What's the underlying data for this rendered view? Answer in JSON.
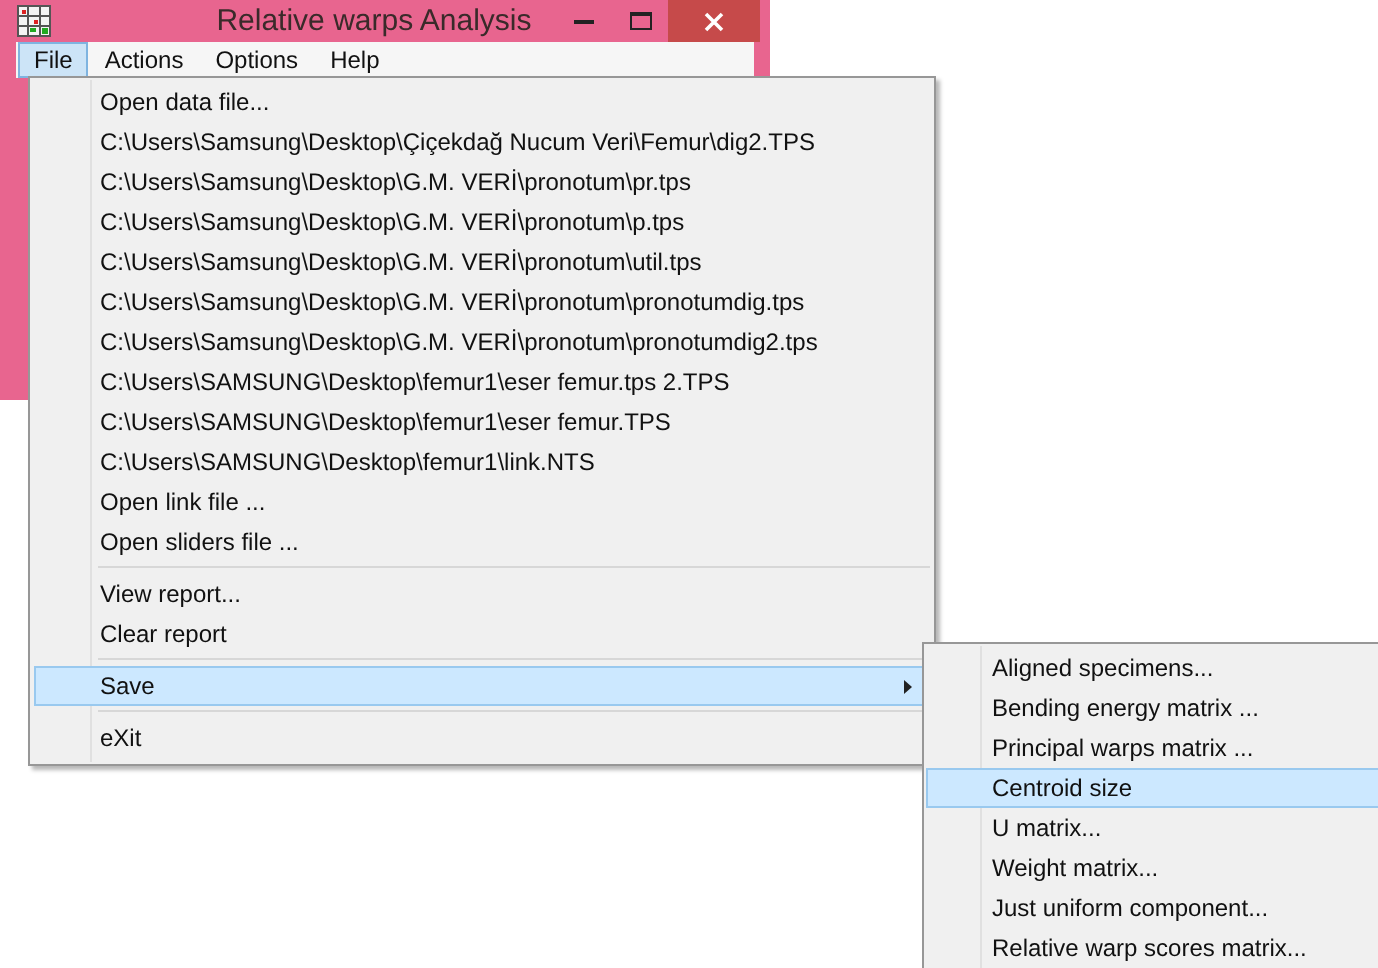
{
  "window": {
    "title": "Relative warps Analysis"
  },
  "menu_bar": [
    {
      "label": "File",
      "selected": true
    },
    {
      "label": "Actions",
      "selected": false
    },
    {
      "label": "Options",
      "selected": false
    },
    {
      "label": "Help",
      "selected": false
    }
  ],
  "file_menu": [
    {
      "kind": "item",
      "label": "Open data file...",
      "selected": false
    },
    {
      "kind": "item",
      "label": "C:\\Users\\Samsung\\Desktop\\Çiçekdağ Nucum Veri\\Femur\\dig2.TPS",
      "selected": false
    },
    {
      "kind": "item",
      "label": "C:\\Users\\Samsung\\Desktop\\G.M. VERİ\\pronotum\\pr.tps",
      "selected": false
    },
    {
      "kind": "item",
      "label": "C:\\Users\\Samsung\\Desktop\\G.M. VERİ\\pronotum\\p.tps",
      "selected": false
    },
    {
      "kind": "item",
      "label": "C:\\Users\\Samsung\\Desktop\\G.M. VERİ\\pronotum\\util.tps",
      "selected": false
    },
    {
      "kind": "item",
      "label": "C:\\Users\\Samsung\\Desktop\\G.M. VERİ\\pronotum\\pronotumdig.tps",
      "selected": false
    },
    {
      "kind": "item",
      "label": "C:\\Users\\Samsung\\Desktop\\G.M. VERİ\\pronotum\\pronotumdig2.tps",
      "selected": false
    },
    {
      "kind": "item",
      "label": "C:\\Users\\SAMSUNG\\Desktop\\femur1\\eser femur.tps 2.TPS",
      "selected": false
    },
    {
      "kind": "item",
      "label": "C:\\Users\\SAMSUNG\\Desktop\\femur1\\eser femur.TPS",
      "selected": false
    },
    {
      "kind": "item",
      "label": "C:\\Users\\SAMSUNG\\Desktop\\femur1\\link.NTS",
      "selected": false
    },
    {
      "kind": "item",
      "label": "Open link file ...",
      "selected": false
    },
    {
      "kind": "item",
      "label": "Open sliders file ...",
      "selected": false
    },
    {
      "kind": "separator"
    },
    {
      "kind": "item",
      "label": "View report...",
      "selected": false
    },
    {
      "kind": "item",
      "label": "Clear report",
      "selected": false
    },
    {
      "kind": "separator"
    },
    {
      "kind": "submenu",
      "label": "Save",
      "selected": true
    },
    {
      "kind": "separator"
    },
    {
      "kind": "item",
      "label": "eXit",
      "selected": false
    }
  ],
  "save_submenu": [
    {
      "label": "Aligned specimens...",
      "selected": false
    },
    {
      "label": "Bending energy matrix ...",
      "selected": false
    },
    {
      "label": "Principal warps matrix ...",
      "selected": false
    },
    {
      "label": "Centroid size",
      "selected": true
    },
    {
      "label": "U matrix...",
      "selected": false
    },
    {
      "label": "Weight matrix...",
      "selected": false
    },
    {
      "label": "Just uniform component...",
      "selected": false
    },
    {
      "label": "Relative warp scores matrix...",
      "selected": false
    }
  ]
}
